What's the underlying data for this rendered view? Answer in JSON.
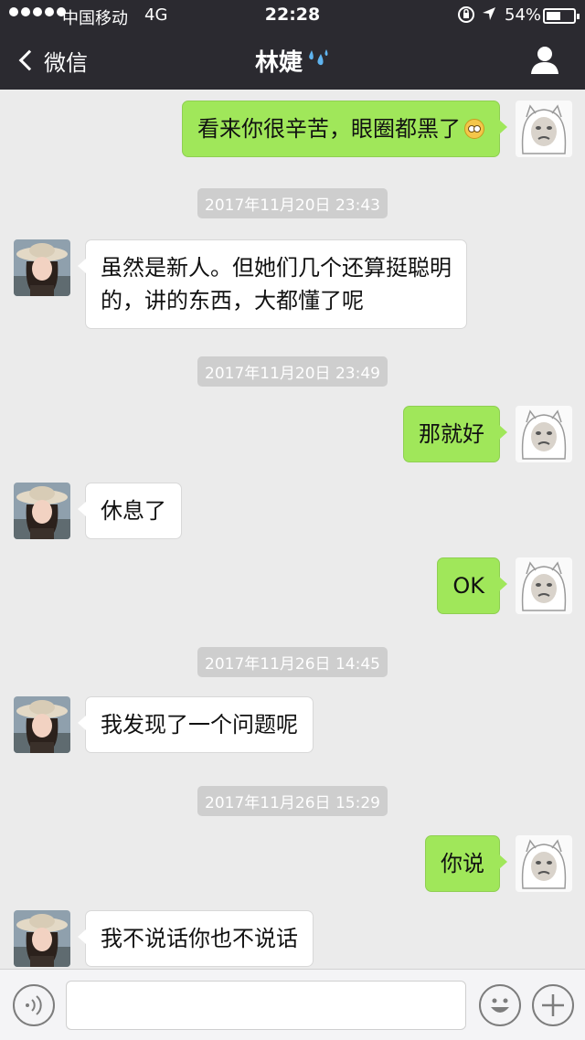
{
  "status_bar": {
    "carrier": "中国移动",
    "network": "4G",
    "time": "22:28",
    "battery": "54%",
    "battery_level": 0.54
  },
  "nav": {
    "back_label": "微信",
    "title": "林婕",
    "title_icon": "sweat-droplets-icon",
    "right_icon": "person-icon"
  },
  "messages": [
    {
      "side": "out",
      "text": "看来你很辛苦，眼圈都黑了",
      "emoji": "flushed-face-emoji"
    },
    {
      "timestamp": "2017年11月20日 23:43"
    },
    {
      "side": "in",
      "lines": [
        "虽然是新人。但她们几个还算挺聪明",
        "的，讲的东西，大都懂了呢"
      ]
    },
    {
      "timestamp": "2017年11月20日 23:49"
    },
    {
      "side": "out",
      "text": "那就好"
    },
    {
      "side": "in",
      "text": "休息了"
    },
    {
      "side": "out",
      "text": "OK"
    },
    {
      "timestamp": "2017年11月26日 14:45"
    },
    {
      "side": "in",
      "text": "我发现了一个问题呢"
    },
    {
      "timestamp": "2017年11月26日 15:29"
    },
    {
      "side": "out",
      "text": "你说"
    },
    {
      "side": "in",
      "text": "我不说话你也不说话"
    }
  ],
  "input_bar": {
    "message_value": "",
    "icons": [
      "voice-icon",
      "emoji-icon",
      "plus-icon"
    ]
  },
  "colors": {
    "nav_bg": "#2b2a30",
    "chat_bg": "#ebebeb",
    "outgoing_bubble": "#a0e75a",
    "incoming_bubble": "#ffffff"
  }
}
